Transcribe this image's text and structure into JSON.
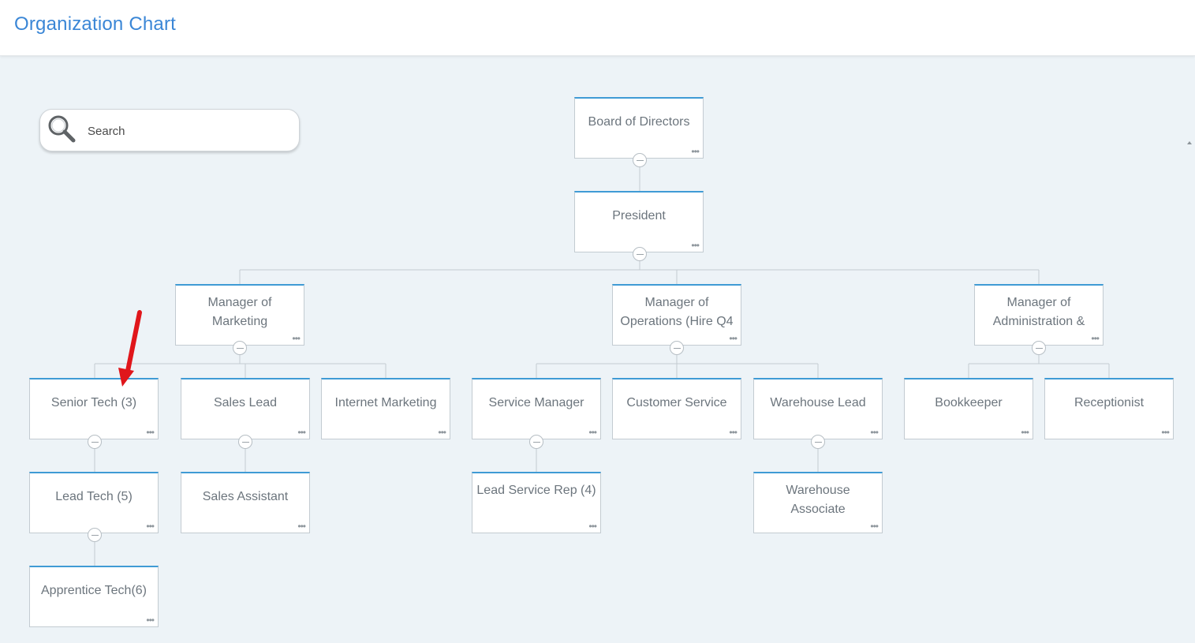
{
  "header": {
    "title": "Organization Chart"
  },
  "search": {
    "placeholder": "Search",
    "value": ""
  },
  "nodes": {
    "board": "Board of Directors",
    "president": "President",
    "mgr_marketing": "Manager of Marketing",
    "mgr_operations": "Manager of Operations (Hire Q4",
    "mgr_admin": "Manager of Administration &",
    "senior_tech": "Senior Tech (3)",
    "sales_lead": "Sales Lead",
    "internet_marketing": "Internet Marketing",
    "service_manager": "Service Manager",
    "customer_service": "Customer Service",
    "warehouse_lead": "Warehouse Lead",
    "bookkeeper": "Bookkeeper",
    "receptionist": "Receptionist",
    "lead_tech": "Lead Tech (5)",
    "sales_assistant": "Sales Assistant",
    "lead_service_rep": "Lead Service Rep (4)",
    "warehouse_associate": "Warehouse Associate",
    "apprentice_tech": "Apprentice Tech(6)"
  },
  "more_glyph": "•••",
  "colors": {
    "accent": "#3a86d6",
    "node_top_border": "#3f9bd5",
    "canvas_bg": "#edf3f7",
    "connector": "#c3cbd1",
    "annotation_arrow": "#e0161b"
  }
}
